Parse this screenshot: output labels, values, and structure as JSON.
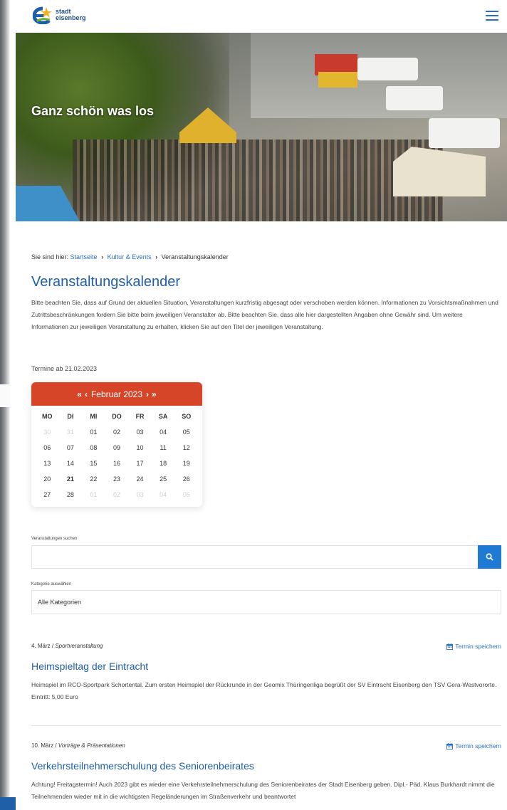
{
  "header": {
    "logo_line1": "stadt",
    "logo_line2": "eisenberg"
  },
  "hero": {
    "title": "Ganz schön was los"
  },
  "breadcrumb": {
    "prefix": "Sie sind hier:",
    "items": [
      "Startseite",
      "Kultur & Events",
      "Veranstaltungskalender"
    ]
  },
  "page": {
    "title": "Veranstaltungskalender",
    "intro": "Bitte beachten Sie, dass auf Grund der aktuellen Situation, Veranstaltungen kurzfristig abgesagt oder verschoben werden können. Informationen zu Vorsichtsmaßnahmen und Zutrittsbeschränkungen fordern Sie bitte beim jeweiligen Veranstalter ab. Bitte beachten Sie, dass alle hier dargestellten Angaben ohne Gewähr sind. Um weitere Informationen zur jeweiligen Veranstaltung zu erhalten, klicken Sie auf den Titel der jeweiligen Veranstaltung.",
    "termine_ab": "Termine ab 21.02.2023"
  },
  "calendar": {
    "prev_year": "«",
    "prev_month": "‹",
    "month_label": "Februar 2023",
    "next_month": "›",
    "next_year": "»",
    "weekdays": [
      "MO",
      "DI",
      "MI",
      "DO",
      "FR",
      "SA",
      "SO"
    ],
    "days": [
      "30",
      "31",
      "01",
      "02",
      "03",
      "04",
      "05",
      "06",
      "07",
      "08",
      "09",
      "10",
      "11",
      "12",
      "13",
      "14",
      "15",
      "16",
      "17",
      "18",
      "19",
      "20",
      "21",
      "22",
      "23",
      "24",
      "25",
      "26",
      "27",
      "28",
      "01",
      "02",
      "03",
      "04",
      "05"
    ],
    "muted": [
      0,
      1,
      30,
      31,
      32,
      33,
      34
    ],
    "today": 22
  },
  "search": {
    "label": "Veranstaltungen suchen",
    "value": "",
    "placeholder": ""
  },
  "category": {
    "label": "Kategorie auswählen",
    "selected": "Alle Kategorien"
  },
  "events": [
    {
      "date": "4. März",
      "category": "Sportveranstaltung",
      "save_label": "Termin speichern",
      "title": "Heimspieltag der Eintracht",
      "text": "Heimspiel im RCO-Sportpark Schortental. Zum ersten Heimspiel der Rückrunde in der Geomix Thüringenliga begrüßt der SV Eintracht Eisenberg den TSV Gera-Westvororte. Eintritt: 5,00 Euro"
    },
    {
      "date": "10. März",
      "category": "Vorträge & Präsentationen",
      "save_label": "Termin speichern",
      "title": "Verkehrsteilnehmerschulung des Seniorenbeirates",
      "text": "Achtung! Freitagstermin! Auch 2023 gibt es wieder eine Verkehrsteilnehmerschulung des Seniorenbeirates der Stadt Eisenberg geben. Dipl.- Päd. Klaus Burkhardt nimmt die Teilnehmenden wieder mit in die wichtigsten Regeländerungen im Straßenverkehr und beantwortet"
    }
  ],
  "colors": {
    "accent_blue": "#1f5fa8",
    "link_blue": "#2a6fc1",
    "calendar_red": "#d64527",
    "button_blue": "#1f7ad4"
  }
}
